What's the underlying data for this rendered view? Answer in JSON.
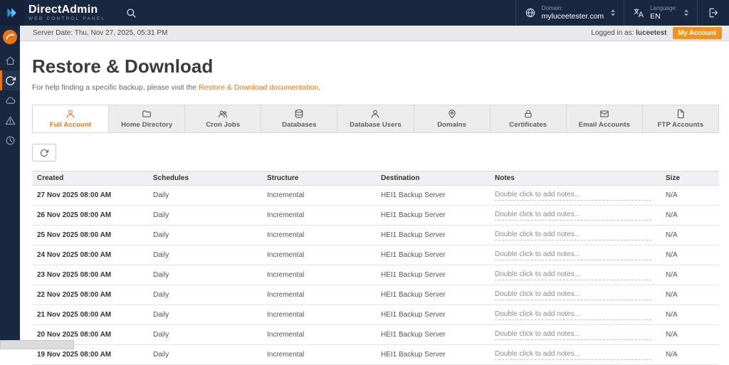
{
  "colors": {
    "accent": "#e87511",
    "topbar_bg": "#1a2740",
    "logo_blue": "#3fa9f5",
    "my_account_bg": "#f0941f"
  },
  "topbar": {
    "brand": "DirectAdmin",
    "brand_sub": "web control panel",
    "domain": {
      "label": "Domain:",
      "value": "myluceetester.com"
    },
    "language": {
      "label": "Language:",
      "value": "EN"
    }
  },
  "statusbar": {
    "server_date": "Server Date: Thu, Nov 27, 2025, 05:31 PM",
    "logged_in_label": "Logged in as: ",
    "logged_in_user": "luceetest",
    "my_account_label": "My Account"
  },
  "page": {
    "title": "Restore & Download",
    "help_prefix": "For help finding a specific backup, please visit the ",
    "help_link": "Restore & Download documentation",
    "help_suffix": "."
  },
  "sidebar": {
    "items": [
      {
        "icon": "home",
        "active": false
      },
      {
        "icon": "refresh",
        "active": true
      },
      {
        "icon": "cloud",
        "active": false
      },
      {
        "icon": "warning",
        "active": false
      },
      {
        "icon": "clock",
        "active": false
      }
    ]
  },
  "tabs": [
    {
      "label": "Full Account",
      "icon": "user",
      "active": true
    },
    {
      "label": "Home Directory",
      "icon": "folder",
      "active": false
    },
    {
      "label": "Cron Jobs",
      "icon": "users",
      "active": false
    },
    {
      "label": "Databases",
      "icon": "database",
      "active": false
    },
    {
      "label": "Database Users",
      "icon": "user",
      "active": false
    },
    {
      "label": "Domains",
      "icon": "pin",
      "active": false
    },
    {
      "label": "Certificates",
      "icon": "lock",
      "active": false
    },
    {
      "label": "Email Accounts",
      "icon": "envelope",
      "active": false
    },
    {
      "label": "FTP Accounts",
      "icon": "file",
      "active": false
    }
  ],
  "table": {
    "headers": [
      "Created",
      "Schedules",
      "Structure",
      "Destination",
      "Notes",
      "Size"
    ],
    "rows": [
      {
        "created": "27 Nov 2025 08:00 AM",
        "schedules": "Daily",
        "structure": "Incremental",
        "destination": "HEI1 Backup Server",
        "notes": "Double click to add notes...",
        "size": "N/A"
      },
      {
        "created": "26 Nov 2025 08:00 AM",
        "schedules": "Daily",
        "structure": "Incremental",
        "destination": "HEI1 Backup Server",
        "notes": "Double click to add notes...",
        "size": "N/A"
      },
      {
        "created": "25 Nov 2025 08:00 AM",
        "schedules": "Daily",
        "structure": "Incremental",
        "destination": "HEI1 Backup Server",
        "notes": "Double click to add notes...",
        "size": "N/A"
      },
      {
        "created": "24 Nov 2025 08:00 AM",
        "schedules": "Daily",
        "structure": "Incremental",
        "destination": "HEI1 Backup Server",
        "notes": "Double click to add notes...",
        "size": "N/A"
      },
      {
        "created": "23 Nov 2025 08:00 AM",
        "schedules": "Daily",
        "structure": "Incremental",
        "destination": "HEI1 Backup Server",
        "notes": "Double click to add notes...",
        "size": "N/A"
      },
      {
        "created": "22 Nov 2025 08:00 AM",
        "schedules": "Daily",
        "structure": "Incremental",
        "destination": "HEI1 Backup Server",
        "notes": "Double click to add notes...",
        "size": "N/A"
      },
      {
        "created": "21 Nov 2025 08:00 AM",
        "schedules": "Daily",
        "structure": "Incremental",
        "destination": "HEI1 Backup Server",
        "notes": "Double click to add notes...",
        "size": "N/A"
      },
      {
        "created": "20 Nov 2025 08:00 AM",
        "schedules": "Daily",
        "structure": "Incremental",
        "destination": "HEI1 Backup Server",
        "notes": "Double click to add notes...",
        "size": "N/A"
      },
      {
        "created": "19 Nov 2025 08:00 AM",
        "schedules": "Daily",
        "structure": "Incremental",
        "destination": "HEI1 Backup Server",
        "notes": "Double click to add notes...",
        "size": "N/A"
      }
    ]
  }
}
